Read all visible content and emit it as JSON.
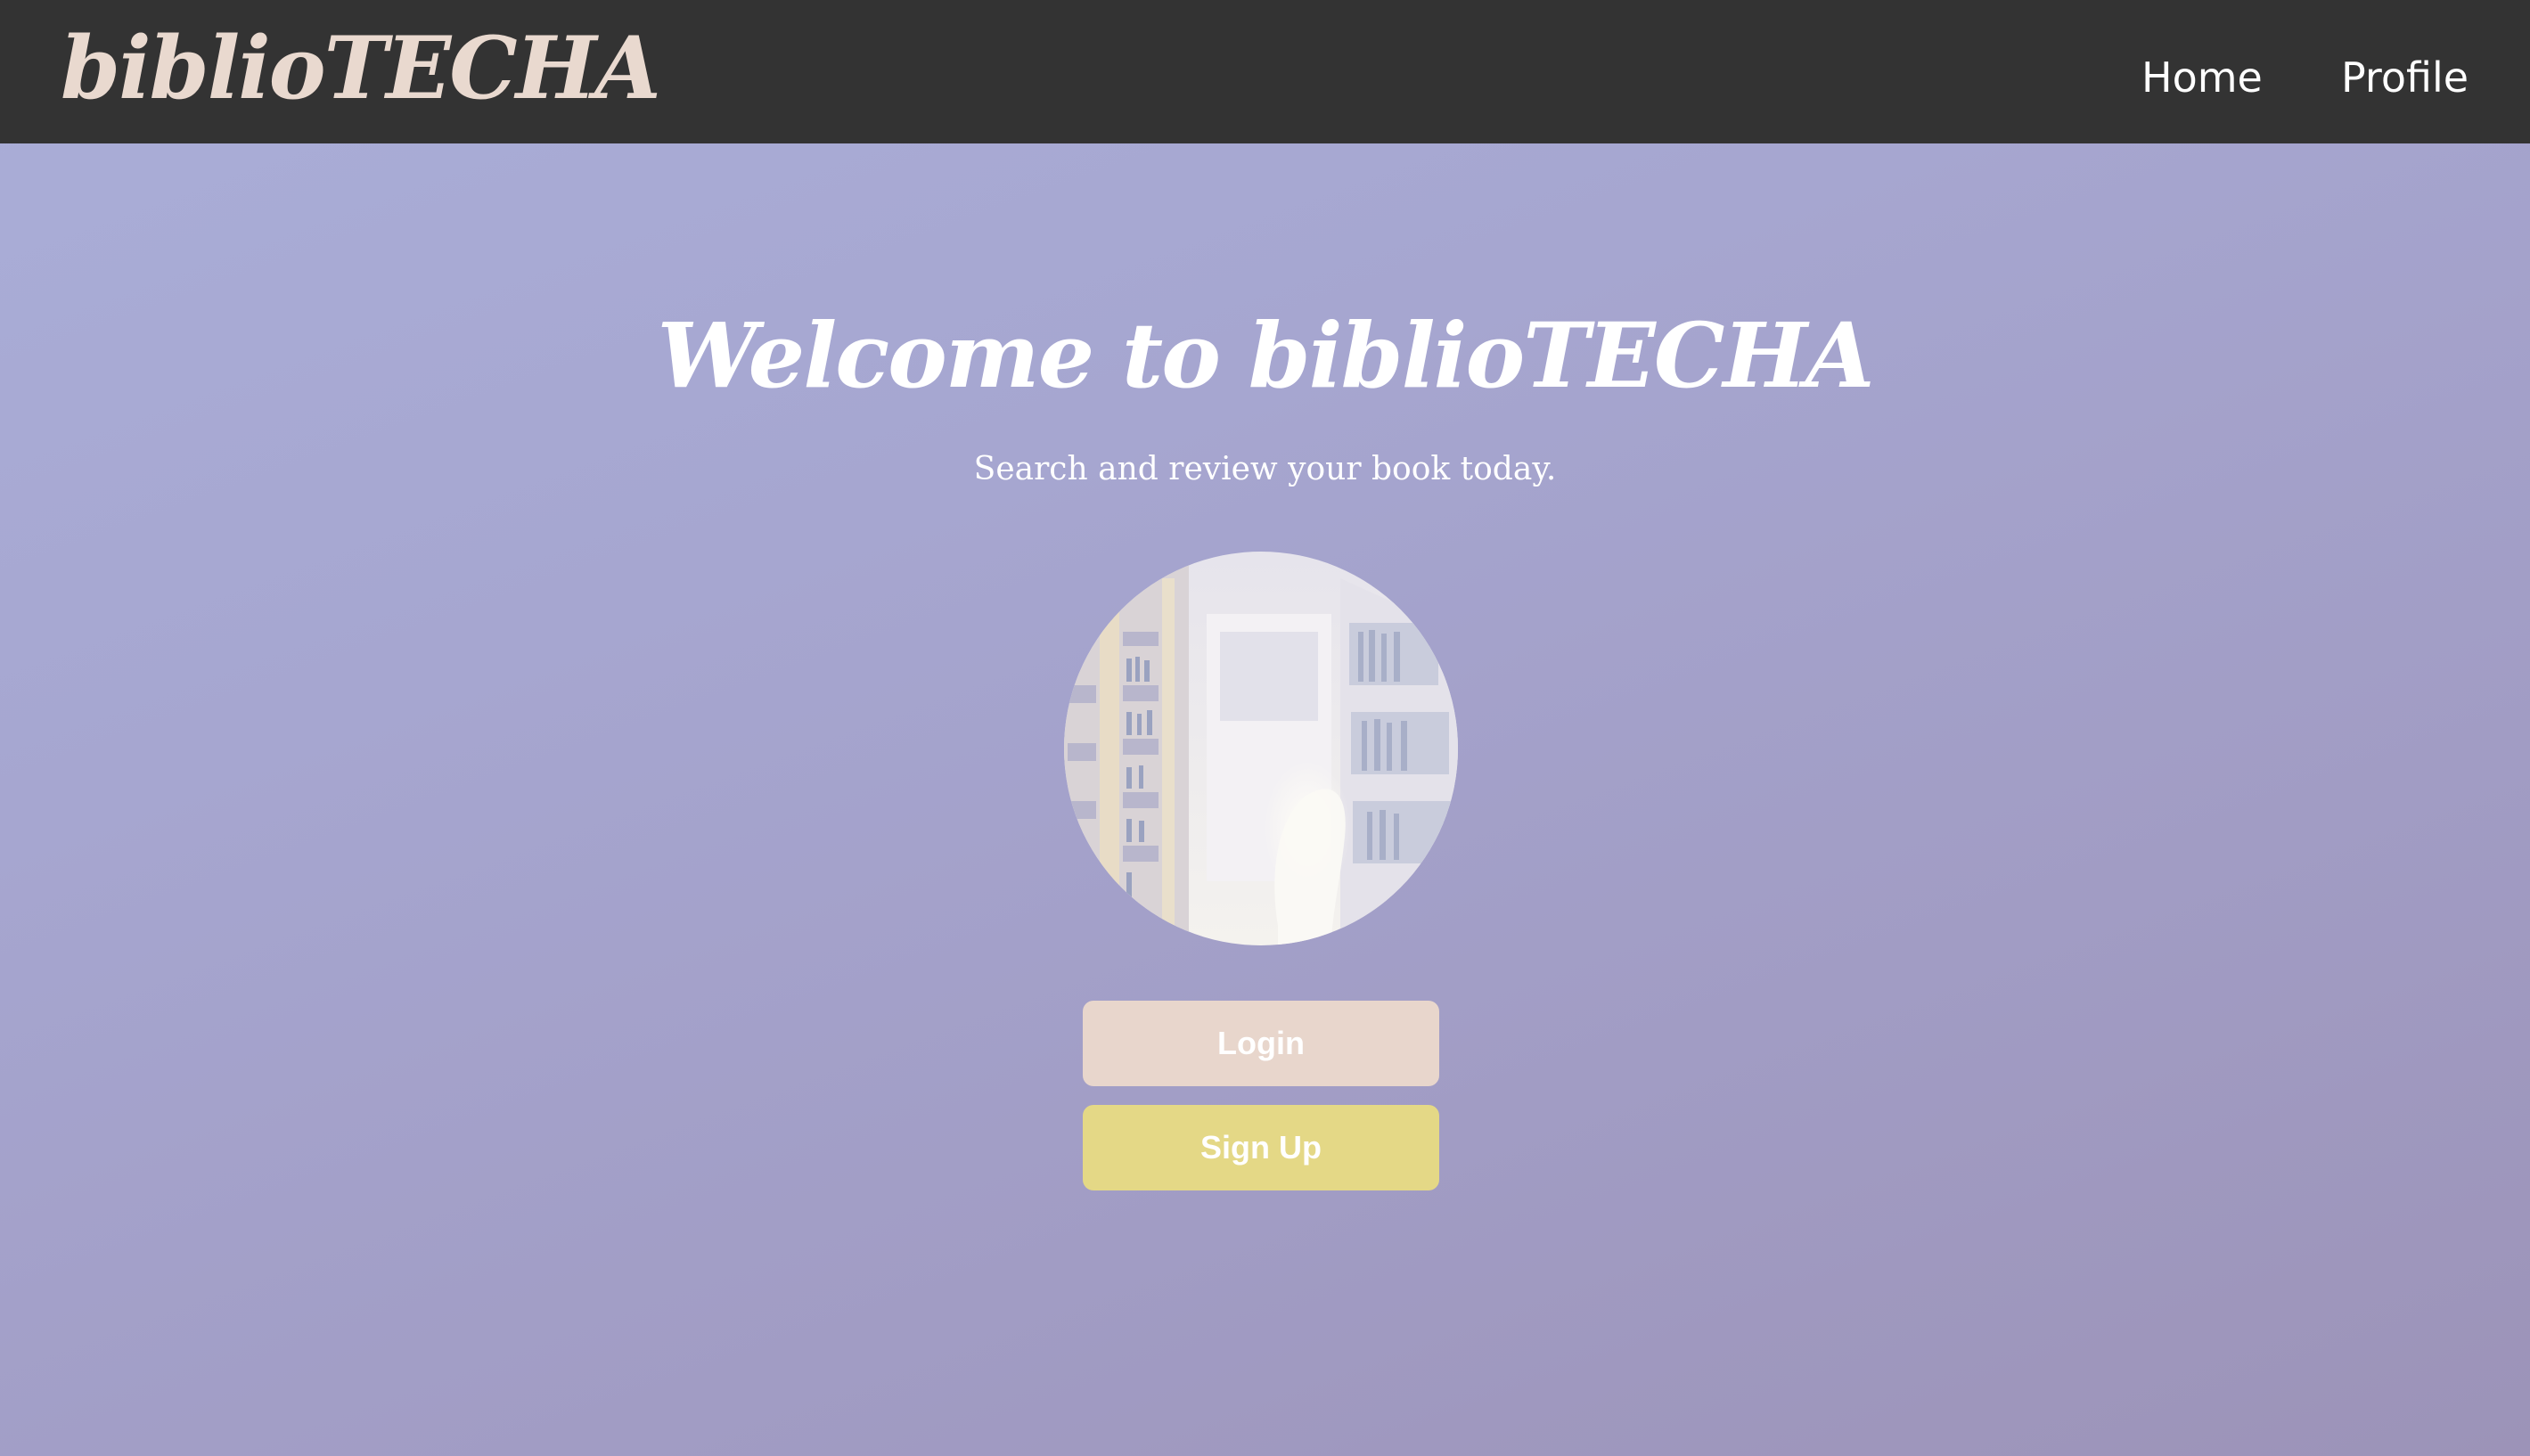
{
  "navbar": {
    "brand": "biblioTECHA",
    "links": [
      {
        "label": "Home"
      },
      {
        "label": "Profile"
      }
    ]
  },
  "hero": {
    "title": "Welcome to biblioTECHA",
    "subtitle": "Search and review your book today.",
    "image_subject": "library-bookshelves-image"
  },
  "actions": {
    "login_label": "Login",
    "signup_label": "Sign Up"
  },
  "colors": {
    "navbar_background": "#333333",
    "brand_text": "#e9d9cf",
    "page_gradient_start": "#aaaed8",
    "page_gradient_end": "#9c93b8",
    "login_button": "#e8d6cc",
    "signup_button": "#e4d886"
  }
}
